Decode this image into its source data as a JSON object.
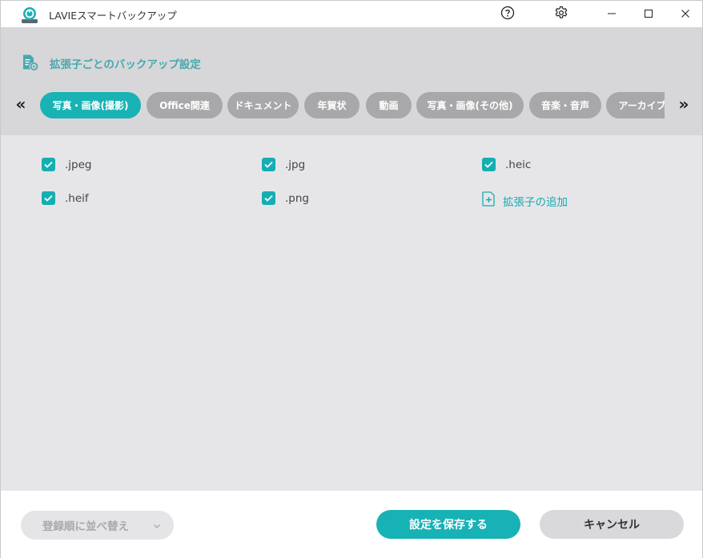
{
  "app": {
    "title": "LAVIEスマートバックアップ",
    "icon": "backup-drive-icon"
  },
  "titlebar": {
    "help_icon": "help-circle-icon",
    "settings_icon": "gear-icon",
    "minimize_icon": "minimize-icon",
    "maximize_icon": "maximize-icon",
    "close_icon": "close-icon"
  },
  "header": {
    "title": "拡張子ごとのバックアップ設定",
    "icon": "document-settings-icon",
    "prev_arrow": "«",
    "next_arrow": "»"
  },
  "tabs": [
    {
      "label": "写真・画像(撮影)",
      "active": true
    },
    {
      "label": "Office関連",
      "active": false
    },
    {
      "label": "ドキュメント",
      "active": false
    },
    {
      "label": "年賀状",
      "active": false
    },
    {
      "label": "動画",
      "active": false
    },
    {
      "label": "写真・画像(その他)",
      "active": false
    },
    {
      "label": "音楽・音声",
      "active": false
    },
    {
      "label": "アーカイブ",
      "active": false
    }
  ],
  "extensions": [
    {
      "label": ".jpeg",
      "checked": true
    },
    {
      "label": ".jpg",
      "checked": true
    },
    {
      "label": ".heic",
      "checked": true
    },
    {
      "label": ".heif",
      "checked": true
    },
    {
      "label": ".png",
      "checked": true
    }
  ],
  "add_extension": {
    "label": "拡張子の追加",
    "icon": "add-file-icon"
  },
  "footer": {
    "sort_label": "登録順に並べ替え",
    "save_label": "設定を保存する",
    "cancel_label": "キャンセル"
  },
  "colors": {
    "accent": "#19b2b5",
    "tab_inactive": "#a8a8aa",
    "header_bg": "#d7d7d9",
    "content_bg": "#e6e6e9"
  }
}
